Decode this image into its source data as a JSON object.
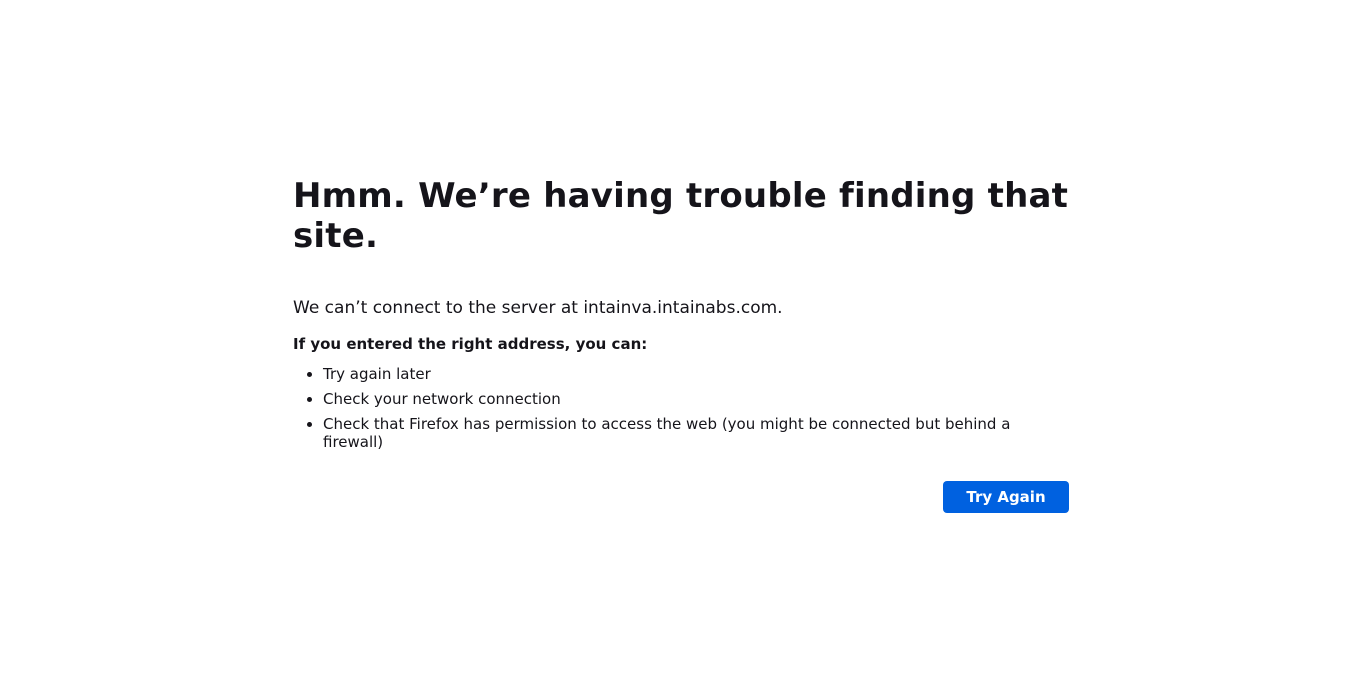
{
  "error": {
    "title": "Hmm. We’re having trouble finding that site.",
    "description": "We can’t connect to the server at intainva.intainabs.com.",
    "suggestions_heading": "If you entered the right address, you can:",
    "suggestions": [
      "Try again later",
      "Check your network connection",
      "Check that Firefox has permission to access the web (you might be connected but behind a firewall)"
    ],
    "try_again_label": "Try Again"
  },
  "colors": {
    "button": "#0061e0",
    "text": "#15141a",
    "background": "#ffffff"
  }
}
